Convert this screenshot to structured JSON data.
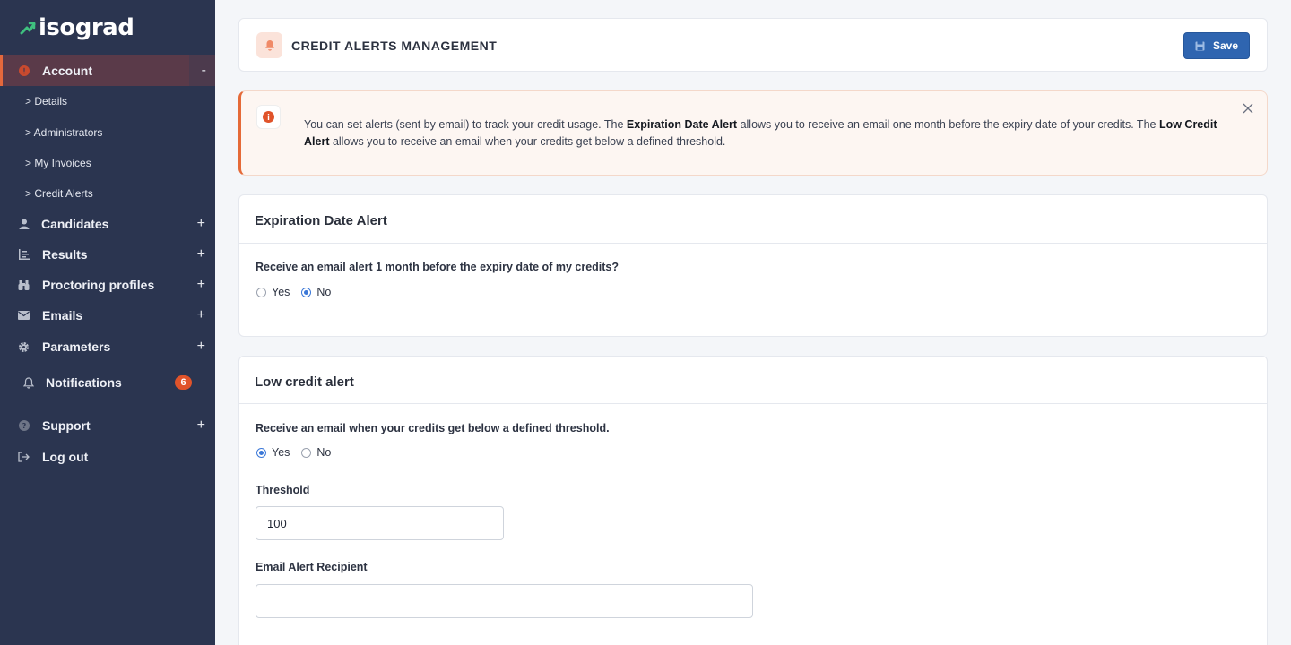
{
  "app": {
    "logo_text": "isograd"
  },
  "sidebar": {
    "account": {
      "label": "Account",
      "toggle": "-"
    },
    "sub_items": [
      "> Details",
      "> Administrators",
      "> My Invoices",
      "> Credit Alerts"
    ],
    "items": [
      {
        "label": "Candidates",
        "icon": "person-icon",
        "toggle": "+"
      },
      {
        "label": "Results",
        "icon": "list-chart-icon",
        "toggle": "+"
      },
      {
        "label": "Proctoring profiles",
        "icon": "binoculars-icon",
        "toggle": "+"
      },
      {
        "label": "Emails",
        "icon": "envelope-icon",
        "toggle": "+"
      },
      {
        "label": "Parameters",
        "icon": "gear-icon",
        "toggle": "+"
      }
    ],
    "notifications": {
      "label": "Notifications",
      "count": "6"
    },
    "support": {
      "label": "Support",
      "toggle": "+"
    },
    "logout": {
      "label": "Log out"
    }
  },
  "header": {
    "title": "CREDIT ALERTS MANAGEMENT",
    "save_label": "Save"
  },
  "info_alert": {
    "text_1": "You can set alerts (sent by email) to track your credit usage. The ",
    "bold_1": "Expiration Date Alert",
    "text_2": " allows you to receive an email one month before the expiry date of your credits. The ",
    "bold_2": "Low Credit Alert",
    "text_3": " allows you to receive an email when your credits get below a defined threshold."
  },
  "expiration": {
    "title": "Expiration Date Alert",
    "question": "Receive an email alert 1 month before the expiry date of my credits?",
    "yes": "Yes",
    "no": "No",
    "selected": "No"
  },
  "low_credit": {
    "title": "Low credit alert",
    "question": "Receive an email when your credits get below a defined threshold.",
    "yes": "Yes",
    "no": "No",
    "selected": "Yes",
    "threshold_label": "Threshold",
    "threshold_value": "100",
    "recipient_label": "Email Alert Recipient",
    "recipient_value": ""
  },
  "colors": {
    "sidebar_bg": "#2b3550",
    "accent": "#e4683c",
    "primary": "#2f65b0",
    "badge": "#e0532a"
  }
}
